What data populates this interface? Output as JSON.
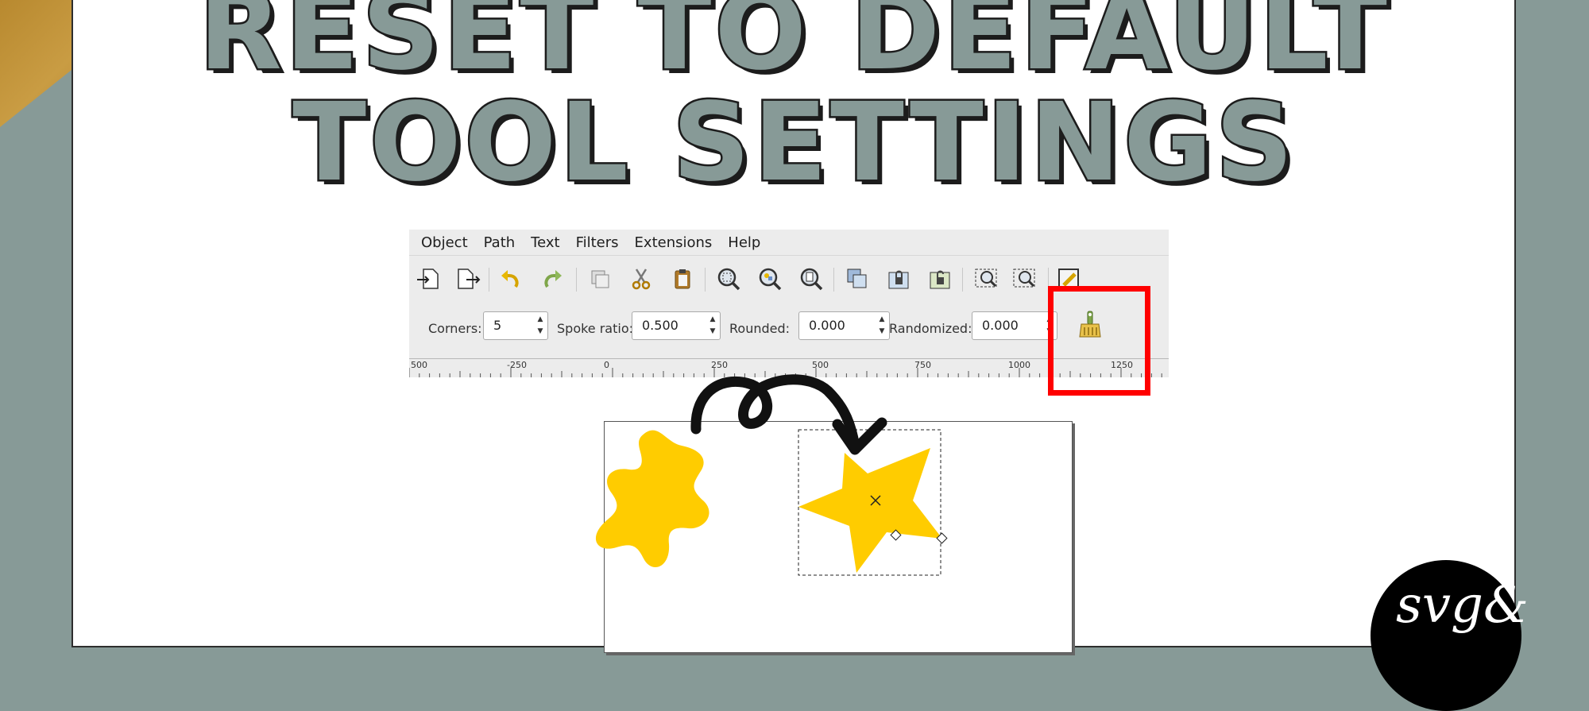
{
  "title": {
    "line1": "RESET TO DEFAULT",
    "line2": "TOOL SETTINGS"
  },
  "menubar": {
    "items": [
      "Object",
      "Path",
      "Text",
      "Filters",
      "Extensions",
      "Help"
    ]
  },
  "star_tool": {
    "corners_label": "Corners:",
    "corners_value": "5",
    "spoke_ratio_label": "Spoke ratio:",
    "spoke_ratio_value": "0.500",
    "rounded_label": "Rounded:",
    "rounded_value": "0.000",
    "randomized_label": "Randomized:",
    "randomized_value": "0.000"
  },
  "ruler": {
    "ticks": [
      "500",
      "-250",
      "0",
      "250",
      "500",
      "750",
      "1000",
      "1250"
    ]
  },
  "logo": {
    "text": "svg&"
  },
  "colors": {
    "star_fill": "#ffcc00",
    "highlight": "#ff0000",
    "background": "#879a97"
  }
}
